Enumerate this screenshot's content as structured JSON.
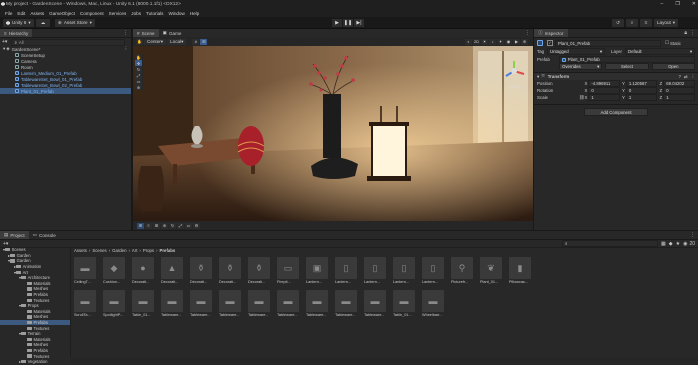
{
  "window": {
    "title": "My project - GardenScene - Windows, Mac, Linux - Unity 6.1 (6000.1.1f1) <DX12>",
    "controls": [
      "–",
      "❐",
      "✕"
    ]
  },
  "menubar": [
    "File",
    "Edit",
    "Assets",
    "GameObject",
    "Component",
    "Services",
    "Jobs",
    "Tutorials",
    "Window",
    "Help"
  ],
  "toolbar": {
    "unity_label": "Unity 6",
    "account_label": "Asset Store",
    "right_label": "Layout"
  },
  "hierarchy": {
    "tab": "Hierarchy",
    "search_placeholder": "All",
    "items": [
      {
        "label": "GardenScene*",
        "indent": 0,
        "type": "scene"
      },
      {
        "label": "SceneSetup",
        "indent": 1,
        "type": "object"
      },
      {
        "label": "Camera",
        "indent": 1,
        "type": "object"
      },
      {
        "label": "Room",
        "indent": 1,
        "type": "object"
      },
      {
        "label": "Lantern_Medium_01_Prefab",
        "indent": 1,
        "type": "prefab"
      },
      {
        "label": "TablewareSet_Bowl_01_Prefab",
        "indent": 1,
        "type": "prefab"
      },
      {
        "label": "TablewareSet_Bowl_02_Prefab",
        "indent": 1,
        "type": "prefab"
      },
      {
        "label": "Plant_01_Prefab",
        "indent": 1,
        "type": "prefab",
        "selected": true
      }
    ]
  },
  "scene": {
    "tabs": [
      "Scene",
      "Game"
    ],
    "center_label": "Center",
    "local_label": "Local",
    "persp_label": "< Persp"
  },
  "inspector": {
    "tab": "Inspector",
    "object_name": "Plant_01_Prefab",
    "static_label": "Static",
    "tag_label": "Tag",
    "tag_value": "Untagged",
    "layer_label": "Layer",
    "layer_value": "Default",
    "prefab_label": "Prefab",
    "prefab_value": "Plant_01_Prefab",
    "overrides_label": "Overrides",
    "select_label": "Select",
    "open_label": "Open",
    "transform_label": "Transform",
    "rows": [
      {
        "label": "Position",
        "x": "-4.896911",
        "y": "1.120587",
        "z": "69.04202"
      },
      {
        "label": "Rotation",
        "x": "0",
        "y": "0",
        "z": "0"
      },
      {
        "label": "Scale",
        "x": "1",
        "y": "1",
        "z": "1"
      }
    ],
    "add_component_label": "Add Component"
  },
  "project": {
    "tabs": [
      "Project",
      "Console"
    ],
    "breadcrumb": [
      "Assets",
      "Scenes",
      "Garden",
      "Art",
      "Props",
      "Prefabs"
    ],
    "tree": [
      {
        "label": "Scenes",
        "indent": 0
      },
      {
        "label": "Garden",
        "indent": 1
      },
      {
        "label": "Garden",
        "indent": 1
      },
      {
        "label": "Animation",
        "indent": 2
      },
      {
        "label": "Art",
        "indent": 2
      },
      {
        "label": "Architecture",
        "indent": 3
      },
      {
        "label": "Materials",
        "indent": 4
      },
      {
        "label": "Meshes",
        "indent": 4
      },
      {
        "label": "Prefabs",
        "indent": 4
      },
      {
        "label": "Textures",
        "indent": 4
      },
      {
        "label": "Props",
        "indent": 3
      },
      {
        "label": "Materials",
        "indent": 4
      },
      {
        "label": "Meshes",
        "indent": 4
      },
      {
        "label": "Prefabs",
        "indent": 4,
        "selected": true
      },
      {
        "label": "Textures",
        "indent": 4
      },
      {
        "label": "Terrain",
        "indent": 3
      },
      {
        "label": "Materials",
        "indent": 4
      },
      {
        "label": "Meshes",
        "indent": 4
      },
      {
        "label": "Prefabs",
        "indent": 4
      },
      {
        "label": "Textures",
        "indent": 4
      },
      {
        "label": "Vegetation",
        "indent": 3
      }
    ],
    "assets_row1": [
      "CeilingT...",
      "Cushion...",
      "Decorati...",
      "Decorati...",
      "Decorati...",
      "Decorati...",
      "Decorati...",
      "Firepit...",
      "Lantern...",
      "Lantern...",
      "Lantern...",
      "Lantern...",
      "Lantern...",
      "Picturefr...",
      "Plant_01...",
      "Pillowcas..."
    ],
    "assets_row2": [
      "ScrollTa...",
      "SpotlightP...",
      "Table_01...",
      "Tableware...",
      "Tableware...",
      "Tableware...",
      "Tableware...",
      "Tableware...",
      "Tableware...",
      "Tableware...",
      "Tableware...",
      "Table_01...",
      "Wheelbarr..."
    ],
    "asset_count": "20"
  },
  "colors": {
    "selection": "#3c5a80",
    "prefab_text": "#7fb4f5",
    "accent_blue": "#2a4d8a"
  }
}
